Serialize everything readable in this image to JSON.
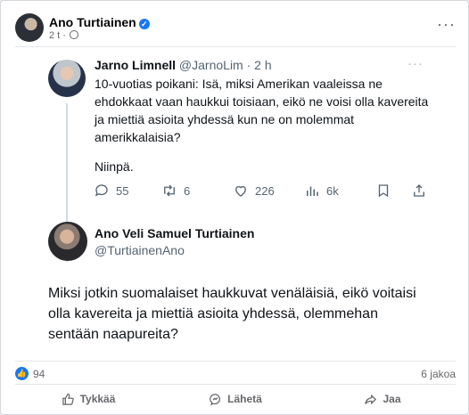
{
  "post": {
    "author": "Ano Turtiainen",
    "time": "2 t",
    "more": "···"
  },
  "tweet1": {
    "name": "Jarno Limnell",
    "handle": "@JarnoLim",
    "time": "· 2 h",
    "more": "···",
    "text": "10-vuotias poikani: Isä, miksi Amerikan vaaleissa ne ehdokkaat vaan haukkui toisiaan, eikö ne voisi olla kavereita ja miettiä asioita yhdessä kun ne on molemmat amerikkalaisia?",
    "text2": "Niinpä.",
    "replies": "55",
    "retweets": "6",
    "likes": "226",
    "views": "6k"
  },
  "tweet2": {
    "name": "Ano Veli Samuel Turtiainen",
    "handle": "@TurtiainenAno",
    "text": "Miksi jotkin suomalaiset haukkuvat venäläisiä, eikö voitaisi olla kavereita ja miettiä asioita yhdessä, olemmehan sentään naapureita?"
  },
  "stats": {
    "like_count": "94",
    "shares": "6 jakoa"
  },
  "actions": {
    "like": "Tykkää",
    "send": "Lähetä",
    "share": "Jaa"
  },
  "colors": {
    "facebook_blue": "#1877f2",
    "twitter_text": "#0f1419",
    "twitter_muted": "#536471"
  }
}
